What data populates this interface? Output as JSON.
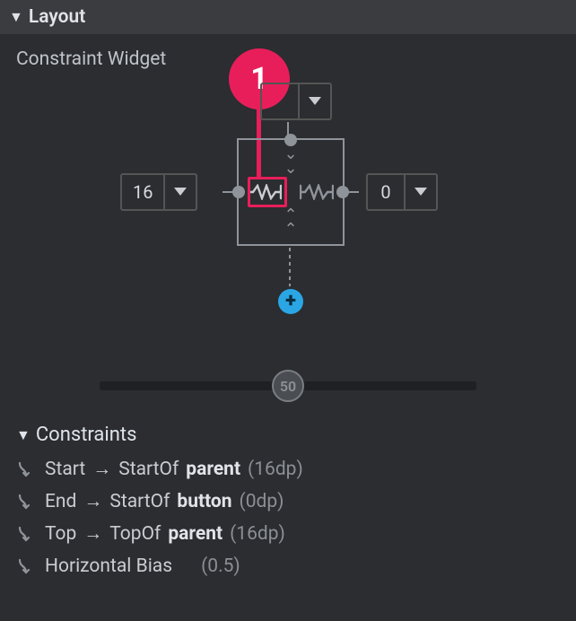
{
  "layout": {
    "header": "Layout",
    "subheader": "Constraint Widget",
    "margins": {
      "top": "",
      "start": "16",
      "end": "0"
    },
    "bottom_handle": "create",
    "callout_label": "1",
    "bias_slider": {
      "value": "50"
    }
  },
  "constraints": {
    "header": "Constraints",
    "rows": [
      {
        "attr": "Start",
        "arrow": "→",
        "rel": "StartOf",
        "target": "parent",
        "value": "(16dp)"
      },
      {
        "attr": "End",
        "arrow": "→",
        "rel": "StartOf",
        "target": "button",
        "value": "(0dp)"
      },
      {
        "attr": "Top",
        "arrow": "→",
        "rel": "TopOf",
        "target": "parent",
        "value": "(16dp)"
      },
      {
        "attr": "Horizontal Bias",
        "arrow": "",
        "rel": "",
        "target": "",
        "value": "(0.5)"
      }
    ]
  }
}
